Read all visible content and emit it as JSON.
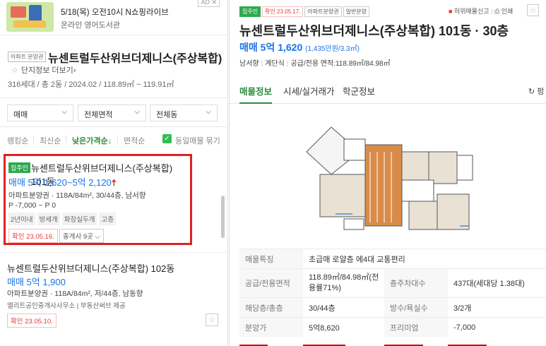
{
  "ad": {
    "badge": "AD ✕",
    "title": "5/18(목) 오전10시 N쇼핑라이브",
    "subtitle": "온라인 영어도서관"
  },
  "complex": {
    "tag": "아파트 분양권",
    "name": "뉴센트럴두산위브더제니스(주상복합)",
    "link": "단지정보 더보기",
    "info": "316세대 / 총 2동 / 2024.02 / 118.89㎡ ~ 119.91㎡"
  },
  "filters": [
    {
      "label": "매매"
    },
    {
      "label": "전체면적"
    },
    {
      "label": "전체동"
    }
  ],
  "sort": {
    "items": [
      "랭킹순",
      "최신순",
      "낮은가격순↓",
      "면적순"
    ],
    "active_index": 2,
    "same_listing": "동일매물 묶기"
  },
  "listings": [
    {
      "tag": "집주인",
      "title": "뉴센트럴두산위브더제니스(주상복합) 101동",
      "price": "매매 5억 1,620~5억 2,120",
      "meta": "아파트분양권 · 118A/84m², 30/44층, 남서향",
      "premium": "P -7,000 ~ P 0",
      "chips": [
        "2년이내",
        "방세개",
        "화장실두개",
        "고층"
      ],
      "confirmed": "확인 23.05.16.",
      "agents": "중개사 9곳"
    },
    {
      "title": "뉴센트럴두산위브더제니스(주상복합) 102동",
      "price": "매매 5억 1,900",
      "meta": "아파트분양권 · 118A/84m², 저/44층, 남동향",
      "agent_info": "엘리트공인중개사사무소 | 부동산써브 제공",
      "confirmed": "확인 23.05.10."
    }
  ],
  "detail": {
    "tags": [
      "집주인",
      "확인 23.05.17.",
      "아파트분양권",
      "일반분양"
    ],
    "report": "허위매물신고",
    "print": "인쇄",
    "title": "뉴센트럴두산위브더제니스(주상복합) 101동 · 30층",
    "price": "매매 5억 1,620",
    "price_sub": "(1,435만원/3.3㎡)",
    "meta": [
      "남서향",
      "계단식",
      "공급/전용 면적:118.89㎡/84.98㎡"
    ],
    "tabs": [
      "매물정보",
      "시세/실거래가",
      "학군정보"
    ],
    "tab_more": "펑",
    "table": {
      "feature_label": "매물특징",
      "feature_value": "초급매 로얄층 에4대 교통편리",
      "area_label": "공급/전용면적",
      "area_value": "118.89㎡/84.98㎡(전용률71%)",
      "households_label": "총주차대수",
      "households_value": "437대(세대당 1.38대)",
      "floor_label": "해당층/총층",
      "floor_value": "30/44층",
      "rooms_label": "방수/욕실수",
      "rooms_value": "3/2개",
      "sale_label": "분양가",
      "sale_value": "5억8,620",
      "premium_label": "프리미엄",
      "premium_value": "-7,000"
    }
  },
  "colors": {
    "accent_green": "#2a8d3b",
    "price_blue": "#1a73e8",
    "highlight_red": "#e02020"
  }
}
